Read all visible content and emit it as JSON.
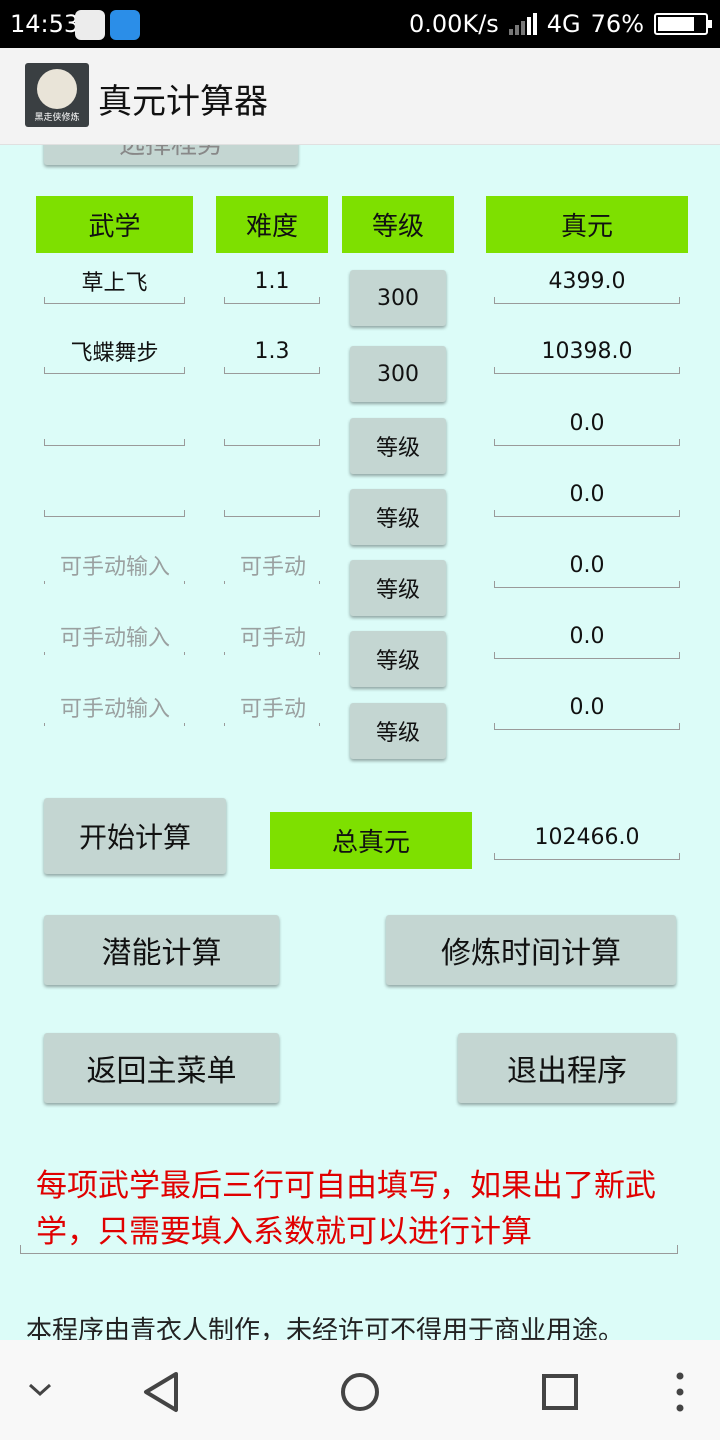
{
  "status_bar": {
    "time": "14:53",
    "net_speed": "0.00K/s",
    "network": "4G",
    "battery": "76%"
  },
  "app": {
    "title": "真元计算器",
    "logo_caption": "黑走侠修炼"
  },
  "top_button": {
    "label": "选择程势"
  },
  "headers": {
    "skill": "武学",
    "difficulty": "难度",
    "level": "等级",
    "zhenyuan": "真元"
  },
  "rows": [
    {
      "skill": "草上飞",
      "skill_placeholder": "",
      "difficulty": "1.1",
      "difficulty_placeholder": "",
      "level": "300",
      "zhenyuan": "4399.0"
    },
    {
      "skill": "飞蝶舞步",
      "skill_placeholder": "",
      "difficulty": "1.3",
      "difficulty_placeholder": "",
      "level": "300",
      "zhenyuan": "10398.0"
    },
    {
      "skill": "",
      "skill_placeholder": "",
      "difficulty": "",
      "difficulty_placeholder": "",
      "level": "等级",
      "zhenyuan": "0.0"
    },
    {
      "skill": "",
      "skill_placeholder": "",
      "difficulty": "",
      "difficulty_placeholder": "",
      "level": "等级",
      "zhenyuan": "0.0"
    },
    {
      "skill": "",
      "skill_placeholder": "可手动输入",
      "difficulty": "",
      "difficulty_placeholder": "可手动",
      "level": "等级",
      "zhenyuan": "0.0"
    },
    {
      "skill": "",
      "skill_placeholder": "可手动输入",
      "difficulty": "",
      "difficulty_placeholder": "可手动",
      "level": "等级",
      "zhenyuan": "0.0"
    },
    {
      "skill": "",
      "skill_placeholder": "可手动输入",
      "difficulty": "",
      "difficulty_placeholder": "可手动",
      "level": "等级",
      "zhenyuan": "0.0"
    }
  ],
  "actions": {
    "start": "开始计算",
    "total_label": "总真元",
    "total_value": "102466.0",
    "potential": "潜能计算",
    "practice_time": "修炼时间计算",
    "back_main": "返回主菜单",
    "exit": "退出程序"
  },
  "note": "每项武学最后三行可自由填写，如果出了新武学，只需要填入系数就可以进行计算",
  "footer": "本程序由青衣人制作，未经许可不得用于商业用途。",
  "colors": {
    "background": "#dcfcf8",
    "header_green": "#7ee000",
    "button_gray": "#c4d6d2",
    "note_red": "#e00000"
  }
}
